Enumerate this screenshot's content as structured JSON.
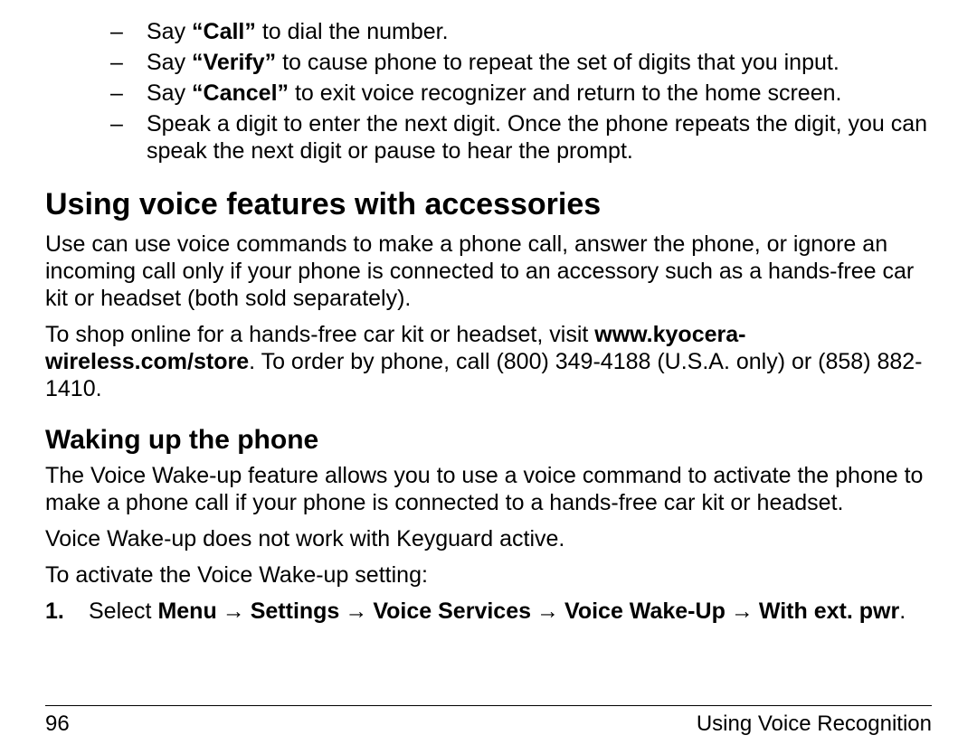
{
  "bullets": {
    "b1_pre": "Say ",
    "b1_bold": "“Call”",
    "b1_post": " to dial the number.",
    "b2_pre": "Say ",
    "b2_bold": "“Verify”",
    "b2_post": " to cause phone to repeat the set of digits that you input.",
    "b3_pre": "Say ",
    "b3_bold": "“Cancel”",
    "b3_post": " to exit voice recognizer and return to the home screen.",
    "b4": "Speak a digit to enter the next digit. Once the phone repeats the digit, you can speak the next digit or pause to hear the prompt."
  },
  "h1": "Using voice features with accessories",
  "p1": "Use can use voice commands to make a phone call, answer the phone, or ignore an incoming call only if your phone is connected to an accessory such as a hands-free car kit or headset (both sold separately).",
  "p2_pre": "To shop online for a hands-free car kit or headset, visit ",
  "p2_bold": "www.kyocera-wireless.com/store",
  "p2_post": ". To order by phone, call (800) 349-4188 (U.S.A. only) or (858) 882-1410.",
  "h2": "Waking up the phone",
  "p3": "The Voice Wake-up feature allows you to use a voice command to activate the phone to make a phone call if your phone is connected to a hands-free car kit or headset.",
  "p4": "Voice Wake-up does not work with Keyguard active.",
  "p5": "To activate the Voice Wake-up setting:",
  "step": {
    "num": "1.",
    "pre": "Select ",
    "m1": "Menu",
    "m2": "Settings",
    "m3": "Voice Services",
    "m4": "Voice Wake-Up",
    "m5": "With ext. pwr",
    "dot": "."
  },
  "footer": {
    "left": "96",
    "right": "Using Voice Recognition"
  },
  "arrow": "→"
}
